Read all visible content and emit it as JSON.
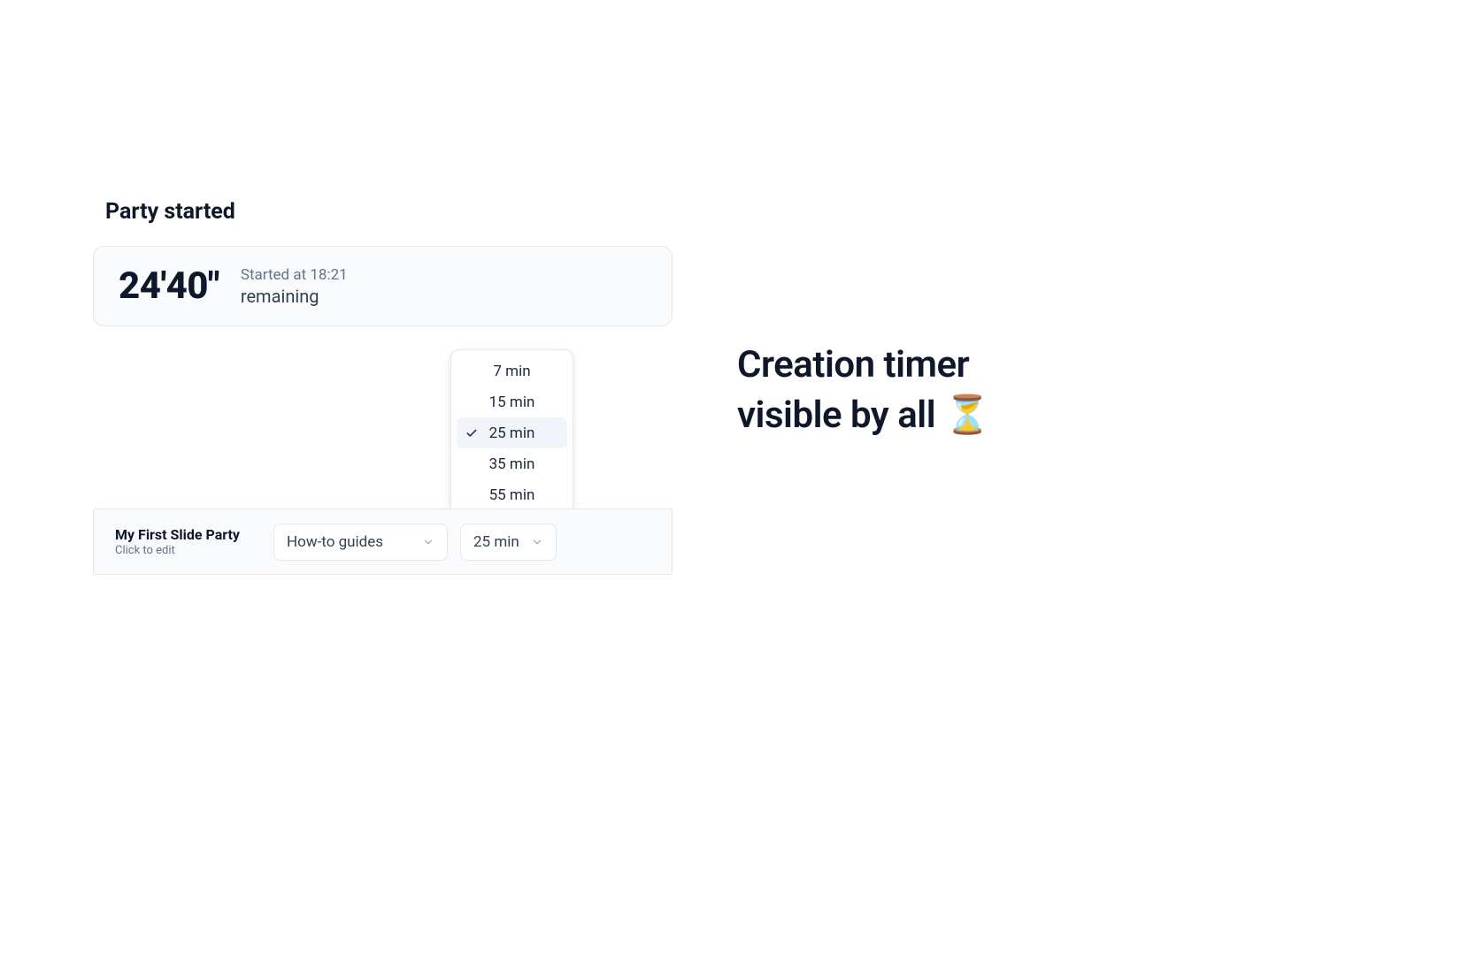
{
  "section": {
    "title": "Party started"
  },
  "timer": {
    "value": "24'40\"",
    "started_at": "Started at 18:21",
    "remaining_label": "remaining"
  },
  "dropdown": {
    "options": [
      "7 min",
      "15 min",
      "25 min",
      "35 min",
      "55 min"
    ],
    "selected_index": 2
  },
  "bottom_bar": {
    "party_name": "My First Slide Party",
    "edit_hint": "Click to edit",
    "guide_select": "How-to guides",
    "time_select": "25 min"
  },
  "caption": {
    "line1": "Creation timer",
    "line2": "visible by all ⏳"
  }
}
